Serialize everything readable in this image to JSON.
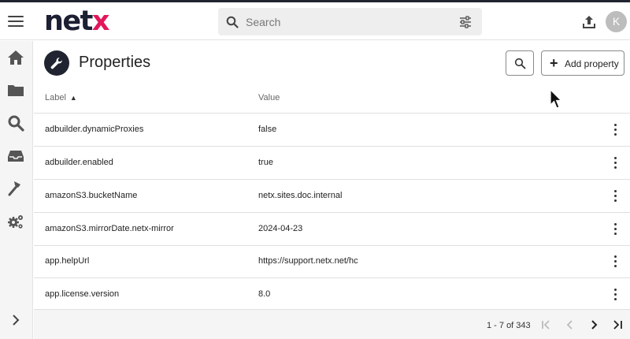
{
  "header": {
    "logo_part1": "net",
    "logo_part2": "x",
    "search_placeholder": "Search",
    "avatar_initial": "K"
  },
  "sidebar": {
    "items": [
      "home-icon",
      "folder-icon",
      "search-icon",
      "inbox-icon",
      "hammer-icon",
      "gears-icon"
    ],
    "expand": "chevron-right-icon"
  },
  "page": {
    "title": "Properties",
    "add_button_label": "Add property"
  },
  "table": {
    "columns": {
      "label": "Label",
      "value": "Value"
    },
    "sort_indicator": "▲",
    "rows": [
      {
        "label": "adbuilder.dynamicProxies",
        "value": "false"
      },
      {
        "label": "adbuilder.enabled",
        "value": "true"
      },
      {
        "label": "amazonS3.bucketName",
        "value": "netx.sites.doc.internal"
      },
      {
        "label": "amazonS3.mirrorDate.netx-mirror",
        "value": "2024-04-23"
      },
      {
        "label": "app.helpUrl",
        "value": "https://support.netx.net/hc"
      },
      {
        "label": "app.license.version",
        "value": "8.0"
      }
    ]
  },
  "pagination": {
    "range_text": "1 - 7 of 343"
  },
  "colors": {
    "brand_dark": "#1d1f33",
    "brand_pink": "#e2175a"
  }
}
